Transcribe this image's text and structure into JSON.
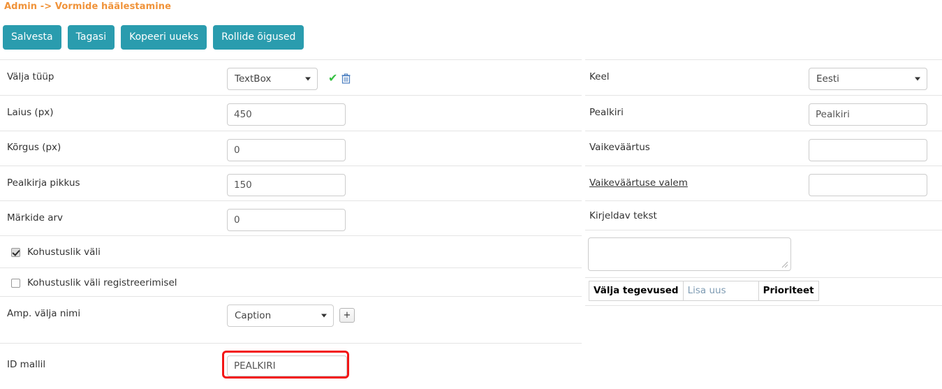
{
  "header": {
    "title": "Admin -> Vormide häälestamine",
    "title_color": "#f0933a"
  },
  "toolbar": {
    "button_color": "#2a9cae",
    "buttons": [
      {
        "label": "Salvesta",
        "name": "save-button"
      },
      {
        "label": "Tagasi",
        "name": "back-button"
      },
      {
        "label": "Kopeeri uueks",
        "name": "copy-as-new-button"
      },
      {
        "label": "Rollide õigused",
        "name": "role-permissions-button"
      }
    ]
  },
  "left_column": {
    "field_type": {
      "label": "Välja tüüp",
      "value": "TextBox",
      "confirm_icon": "check-icon",
      "delete_icon": "trash-icon"
    },
    "width": {
      "label": "Laius (px)",
      "value": "450"
    },
    "height": {
      "label": "Kõrgus (px)",
      "value": "0"
    },
    "caption_length": {
      "label": "Pealkirja pikkus",
      "value": "150"
    },
    "char_count": {
      "label": "Märkide arv",
      "value": "0"
    },
    "required_field": {
      "label": "Kohustuslik väli",
      "checked": true
    },
    "required_on_register": {
      "label": "Kohustuslik väli registreerimisel",
      "checked": false
    },
    "amp_field_name": {
      "label": "Amp. välja nimi",
      "value": "Caption",
      "add_button": "+"
    },
    "id_in_template": {
      "label": "ID mallil",
      "value": "PEALKIRI",
      "highlight_color": "#f31616"
    }
  },
  "right_column": {
    "language": {
      "label": "Keel",
      "value": "Eesti"
    },
    "caption": {
      "label": "Pealkiri",
      "value": "Pealkiri"
    },
    "default_value": {
      "label": "Vaikeväärtus",
      "value": ""
    },
    "default_value_formula": {
      "label": "Vaikeväärtuse valem",
      "value": ""
    },
    "descriptive_text": {
      "label": "Kirjeldav tekst",
      "value": ""
    },
    "field_actions_table": {
      "title": "Välja tegevused",
      "add_new": "Lisa uus",
      "priority": "Prioriteet"
    }
  }
}
